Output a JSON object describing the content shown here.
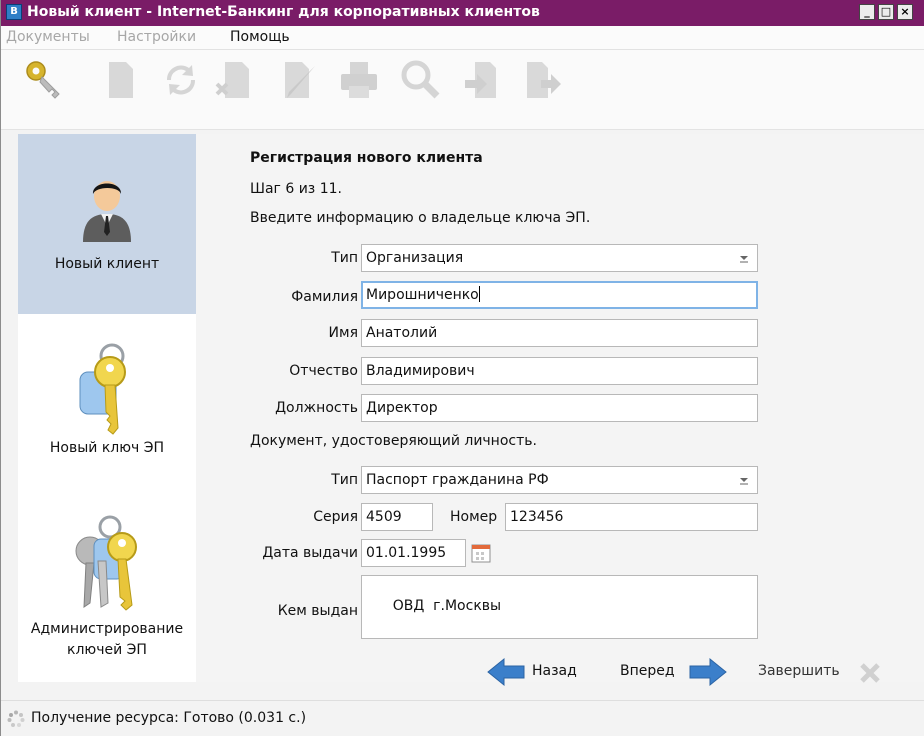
{
  "window": {
    "title": "Новый клиент - Internet-Банкинг для корпоративных клиентов",
    "app_icon": "app-icon",
    "accent": "#7a1c67",
    "controls": {
      "minimize": "_",
      "maximize": "□",
      "close": "×"
    }
  },
  "menu": {
    "items": [
      {
        "label": "Документы",
        "disabled": true
      },
      {
        "label": "Настройки",
        "disabled": true
      },
      {
        "label": "Помощь",
        "disabled": false
      }
    ]
  },
  "toolbar": {
    "icons": [
      "key-icon",
      "new-document-icon",
      "refresh-icon",
      "delete-icon",
      "edit-icon",
      "print-icon",
      "search-icon",
      "import-icon",
      "export-icon"
    ]
  },
  "sidebar": {
    "items": [
      {
        "label": "Новый клиент",
        "icon": "user-icon",
        "active": true
      },
      {
        "label": "Новый ключ ЭП",
        "icon": "key-icon",
        "active": false
      },
      {
        "label": "Администрирование ключей ЭП",
        "label_line1": "Администрирование",
        "label_line2": "ключей ЭП",
        "icon": "keys-icon",
        "active": false
      }
    ]
  },
  "form": {
    "heading": "Регистрация нового клиента",
    "step": "Шаг 6 из 11.",
    "instruction": "Введите информацию о владельце ключа ЭП.",
    "type": {
      "label": "Тип",
      "value": "Организация"
    },
    "last_name": {
      "label": "Фамилия",
      "value": "Мирошниченко"
    },
    "first_name": {
      "label": "Имя",
      "value": "Анатолий"
    },
    "patronymic": {
      "label": "Отчество",
      "value": "Владимирович"
    },
    "position": {
      "label": "Должность",
      "value": "Директор"
    },
    "document_section": "Документ, удостоверяющий личность.",
    "doc_type": {
      "label": "Тип",
      "value": "Паспорт гражданина РФ"
    },
    "series": {
      "label": "Серия",
      "value": "4509"
    },
    "number": {
      "label": "Номер",
      "value": "123456"
    },
    "issue_date": {
      "label": "Дата выдачи",
      "value": "01.01.1995"
    },
    "issued_by": {
      "label": "Кем выдан",
      "value": "ОВД  г.Москвы"
    }
  },
  "buttons": {
    "back": "Назад",
    "next": "Вперед",
    "finish": "Завершить"
  },
  "status": {
    "text": "Получение ресурса: Готово (0.031 с.)"
  }
}
